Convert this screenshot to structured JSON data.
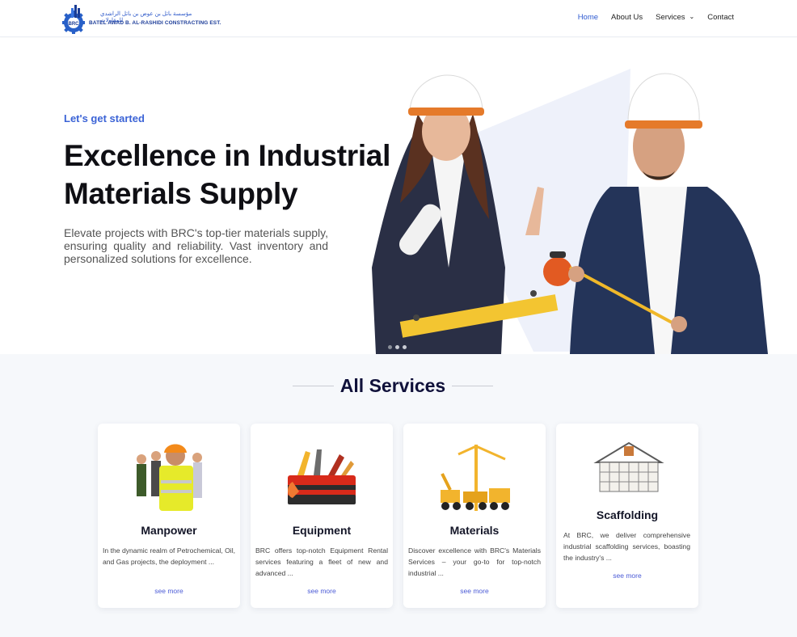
{
  "header": {
    "logo_arabic": "مؤسسة باتل بن عوض بن باتل الراشدي للمقاولات",
    "logo_english": "BATEL AWAD B. AL-RASHIDI CONSTRACTING EST.",
    "logo_badge": "BRC",
    "nav": [
      {
        "label": "Home",
        "active": true
      },
      {
        "label": "About Us"
      },
      {
        "label": "Services",
        "dropdown": true
      },
      {
        "label": "Contact"
      }
    ]
  },
  "hero": {
    "eyebrow": "Let's get started",
    "title": "Excellence in Industrial Materials Supply",
    "text": "Elevate projects with BRC's top-tier materials supply, ensuring quality and reliability. Vast inventory and personalized solutions for excellence.",
    "slides": 3,
    "active_slide": 1,
    "image_icon": "two-engineers-hardhats-photo"
  },
  "services": {
    "title": "All Services",
    "cards": [
      {
        "title": "Manpower",
        "text": "In the dynamic realm of Petrochemical, Oil, and Gas projects, the deployment ...",
        "link": "see more",
        "icon": "workers-group-image"
      },
      {
        "title": "Equipment",
        "text": "BRC offers top-notch Equipment Rental services featuring a fleet of new and advanced ...",
        "link": "see more",
        "icon": "toolbox-image"
      },
      {
        "title": "Materials",
        "text": "Discover excellence with BRC's Materials Services – your go-to for top-notch industrial ...",
        "link": "see more",
        "icon": "construction-machinery-image"
      },
      {
        "title": "Scaffolding",
        "text": "At BRC, we deliver comprehensive industrial scaffolding services, boasting the industry's ...",
        "link": "see more",
        "icon": "scaffolding-house-image"
      }
    ]
  },
  "colors": {
    "accent": "#2f5bd1",
    "title": "#0f0f14",
    "services_bg": "#f6f8fb",
    "link": "#4b5bd6"
  }
}
